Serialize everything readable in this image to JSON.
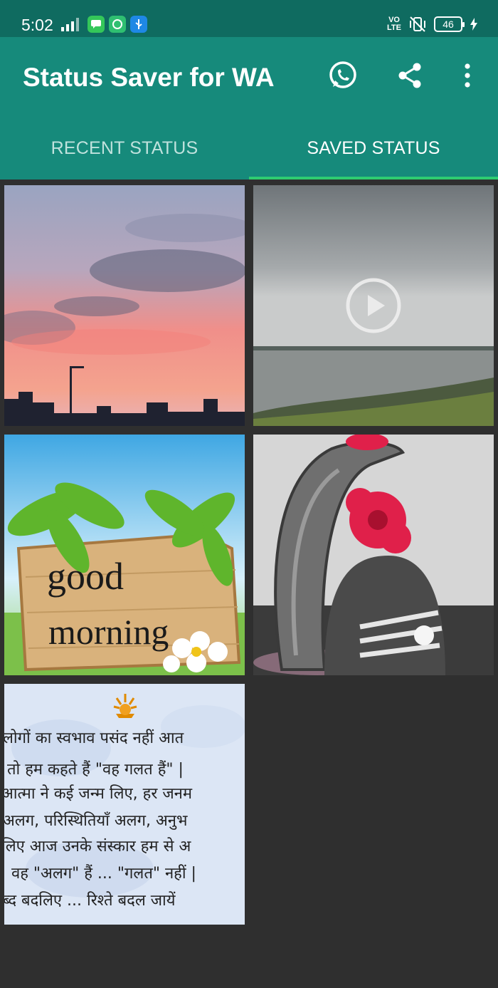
{
  "status_bar": {
    "time": "5:02",
    "volte_top": "VO",
    "volte_bottom": "LTE",
    "battery": "46",
    "icons": [
      "signal-icon",
      "message-icon",
      "chat-bubble-icon",
      "usb-icon",
      "vibrate-off-icon",
      "battery-icon",
      "charging-icon"
    ]
  },
  "app_bar": {
    "title": "Status Saver for WA",
    "actions": [
      "whatsapp-icon",
      "share-icon",
      "more-options-icon"
    ]
  },
  "tabs": [
    {
      "label": "RECENT STATUS",
      "selected": false
    },
    {
      "label": "SAVED STATUS",
      "selected": true
    }
  ],
  "colors": {
    "status_bar": "#0f6b60",
    "app_bar": "#168a7b",
    "tab_indicator": "#2ecc71",
    "background": "#2f2f2f"
  },
  "grid": {
    "items": [
      {
        "kind": "image",
        "icon": "sunset-sky-photo"
      },
      {
        "kind": "video",
        "icon": "play-icon"
      },
      {
        "kind": "image",
        "word1": "good",
        "word2": "morning"
      },
      {
        "kind": "image",
        "icon": "shivling-rose-photo"
      },
      {
        "kind": "image",
        "lines": [
          "लोगों का स्वभाव पसंद नहीं आत",
          "तो हम कहते हैं \"वह गलत हैं\" |",
          "आत्मा ने कई जन्म लिए, हर जनम",
          "अलग, परिस्थितियाँ अलग, अनुभ",
          "लिए आज उनके संस्कार हम से अ",
          "वह \"अलग\" हैं ... \"गलत\" नहीं |",
          "ब्द बदलिए ... रिश्ते बदल जायें"
        ]
      }
    ]
  }
}
